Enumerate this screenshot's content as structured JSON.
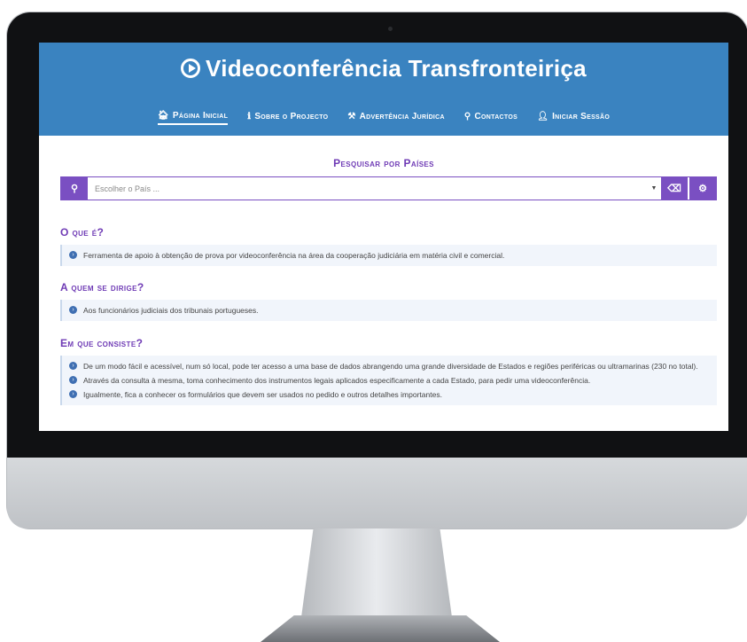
{
  "site": {
    "title": "Videoconferência Transfronteiriça"
  },
  "nav": [
    {
      "label": "Página Inicial",
      "icon": "home-icon",
      "glyph": "🏠︎"
    },
    {
      "label": "Sobre o Projecto",
      "icon": "info-icon",
      "glyph": "ℹ"
    },
    {
      "label": "Advertência Jurídica",
      "icon": "gavel-icon",
      "glyph": "⚒"
    },
    {
      "label": "Contactos",
      "icon": "map-marker-icon",
      "glyph": "⚲"
    },
    {
      "label": "Iniciar Sessão",
      "icon": "user-icon",
      "glyph": "👤︎"
    }
  ],
  "search": {
    "title": "Pesquisar por Países",
    "placeholder": "Escolher o País ...",
    "search_glyph": "⚲",
    "caret_glyph": "▼",
    "eraser_glyph": "⌫",
    "settings_glyph": "⚙"
  },
  "sections": [
    {
      "title": "O que é?",
      "items": [
        "Ferramenta de apoio à obtenção de prova por videoconferência na área da cooperação judiciária em matéria civil e comercial."
      ]
    },
    {
      "title": "A quem se dirige?",
      "items": [
        "Aos funcionários judiciais dos tribunais portugueses."
      ]
    },
    {
      "title": "Em que consiste?",
      "items": [
        "De um modo fácil e acessível, num só local, pode ter acesso a uma base de dados abrangendo uma grande diversidade de Estados e regiões periféricas ou ultramarinas (230 no total).",
        "Através da consulta à mesma, toma conhecimento dos instrumentos legais aplicados especificamente a cada Estado, para pedir uma videoconferência.",
        "Igualmente, fica a conhecer os formulários que devem ser usados no pedido e outros detalhes importantes."
      ]
    }
  ],
  "colors": {
    "header": "#3a83c0",
    "accent": "#7a4fc2",
    "section_title": "#6f3bb5",
    "bullet": "#3f6fb2"
  }
}
